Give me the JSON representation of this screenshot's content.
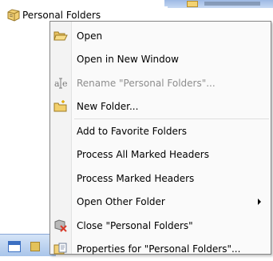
{
  "tree": {
    "folder_label": "Personal Folders",
    "folder_icon": "personal-folders-icon"
  },
  "menu": {
    "items": [
      {
        "label": "Open",
        "icon": "open-folder-icon",
        "enabled": true
      },
      {
        "label": "Open in New Window",
        "icon": "",
        "enabled": true
      },
      {
        "label": "Rename \"Personal Folders\"...",
        "icon": "rename-icon",
        "enabled": false
      },
      {
        "label": "New Folder...",
        "icon": "new-folder-icon",
        "enabled": true
      },
      {
        "label": "Add to Favorite Folders",
        "icon": "",
        "enabled": true
      },
      {
        "label": "Process All Marked Headers",
        "icon": "",
        "enabled": true
      },
      {
        "label": "Process Marked Headers",
        "icon": "",
        "enabled": true
      },
      {
        "label": "Open Other Folder",
        "icon": "",
        "enabled": true,
        "submenu": true
      },
      {
        "label": "Close \"Personal Folders\"",
        "icon": "close-folder-icon",
        "enabled": true
      },
      {
        "label": "Properties for \"Personal Folders\"...",
        "icon": "properties-icon",
        "enabled": true
      }
    ]
  },
  "colors": {
    "menu_background": "#fafafa",
    "menu_border": "#868686",
    "disabled_text": "#8d8d8d",
    "header_blue": "#9db9e4"
  }
}
